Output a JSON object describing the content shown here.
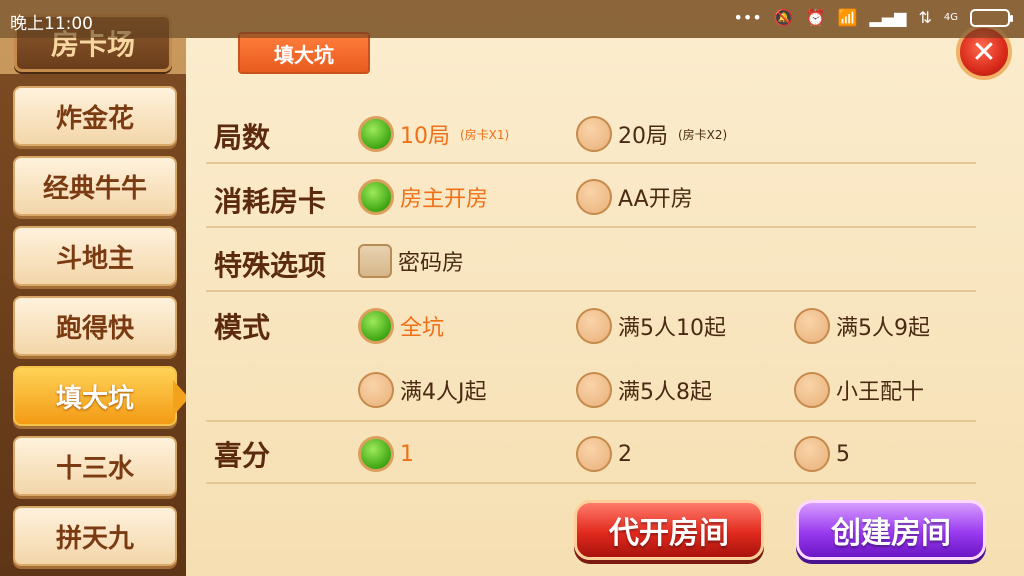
{
  "status_bar": {
    "time": "晚上11:00",
    "icons": [
      "more-icon",
      "mute-icon",
      "alarm-icon",
      "wifi-icon",
      "signal-icon",
      "data-icon",
      "signal-4g-icon",
      "battery-icon"
    ],
    "network_label": "4G"
  },
  "header": {
    "title": "房卡场"
  },
  "sidebar": {
    "items": [
      {
        "label": "炸金花",
        "active": false
      },
      {
        "label": "经典牛牛",
        "active": false
      },
      {
        "label": "斗地主",
        "active": false
      },
      {
        "label": "跑得快",
        "active": false
      },
      {
        "label": "填大坑",
        "active": true
      },
      {
        "label": "十三水",
        "active": false
      },
      {
        "label": "拼天九",
        "active": false
      }
    ]
  },
  "panel": {
    "tab_label": "填大坑",
    "close_symbol": "✕",
    "rounds": {
      "label": "局数",
      "options": [
        {
          "text": "10局",
          "sub": "(房卡X1)",
          "selected": true
        },
        {
          "text": "20局",
          "sub": "(房卡X2)",
          "selected": false
        }
      ]
    },
    "cost": {
      "label": "消耗房卡",
      "options": [
        {
          "text": "房主开房",
          "selected": true
        },
        {
          "text": "AA开房",
          "selected": false
        }
      ]
    },
    "special": {
      "label": "特殊选项",
      "options": [
        {
          "text": "密码房",
          "checked": false
        }
      ]
    },
    "mode": {
      "label": "模式",
      "options": [
        {
          "text": "全坑",
          "selected": true
        },
        {
          "text": "满5人10起",
          "selected": false
        },
        {
          "text": "满5人9起",
          "selected": false
        },
        {
          "text": "满4人J起",
          "selected": false
        },
        {
          "text": "满5人8起",
          "selected": false
        },
        {
          "text": "小王配十",
          "selected": false
        }
      ]
    },
    "xifen": {
      "label": "喜分",
      "options": [
        {
          "text": "1",
          "selected": true
        },
        {
          "text": "2",
          "selected": false
        },
        {
          "text": "5",
          "selected": false
        }
      ]
    },
    "buttons": {
      "proxy_open": "代开房间",
      "create": "创建房间"
    }
  },
  "colors": {
    "accent_orange": "#f07018",
    "selected_green": "#3fa614",
    "btn_red": "#e12a1e",
    "btn_purple": "#9a3bf0"
  }
}
